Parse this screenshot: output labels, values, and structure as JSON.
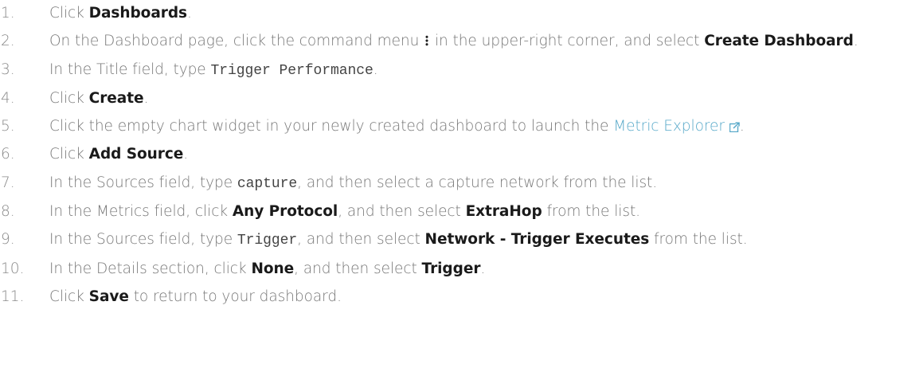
{
  "steps": [
    {
      "num": "1.",
      "parts": [
        "Click ",
        "Dashboards",
        "."
      ]
    },
    {
      "num": "2.",
      "parts": [
        "On the Dashboard page, click the command menu",
        "in the upper-right corner, and select ",
        "Create Dashboard",
        "."
      ]
    },
    {
      "num": "3.",
      "parts": [
        "In the Title field, type ",
        "Trigger Performance",
        "."
      ]
    },
    {
      "num": "4.",
      "parts": [
        "Click ",
        "Create",
        "."
      ]
    },
    {
      "num": "5.",
      "parts": [
        "Click the empty chart widget in your newly created dashboard to launch the ",
        "Metric Explorer",
        "."
      ]
    },
    {
      "num": "6.",
      "parts": [
        "Click ",
        "Add Source",
        "."
      ]
    },
    {
      "num": "7.",
      "parts": [
        "In the Sources field, type ",
        "capture",
        ", and then select a capture network from the list."
      ]
    },
    {
      "num": "8.",
      "parts": [
        "In the Metrics field, click ",
        "Any Protocol",
        ", and then select ",
        "ExtraHop",
        " from the list."
      ]
    },
    {
      "num": "9.",
      "parts": [
        "In the Sources field, type ",
        "Trigger",
        ", and then select ",
        "Network - Trigger Executes",
        " from the list."
      ]
    },
    {
      "num": "10.",
      "parts": [
        "In the Details section, click ",
        "None",
        ", and then select ",
        "Trigger",
        "."
      ]
    },
    {
      "num": "11.",
      "parts": [
        "Click ",
        "Save",
        " to return to your dashboard."
      ]
    }
  ],
  "icons": {
    "command_menu": "kebab-menu-icon",
    "external_link": "external-link-icon"
  },
  "colors": {
    "text": "#777777",
    "bold": "#1a1a1a",
    "link": "#58a9c9"
  }
}
